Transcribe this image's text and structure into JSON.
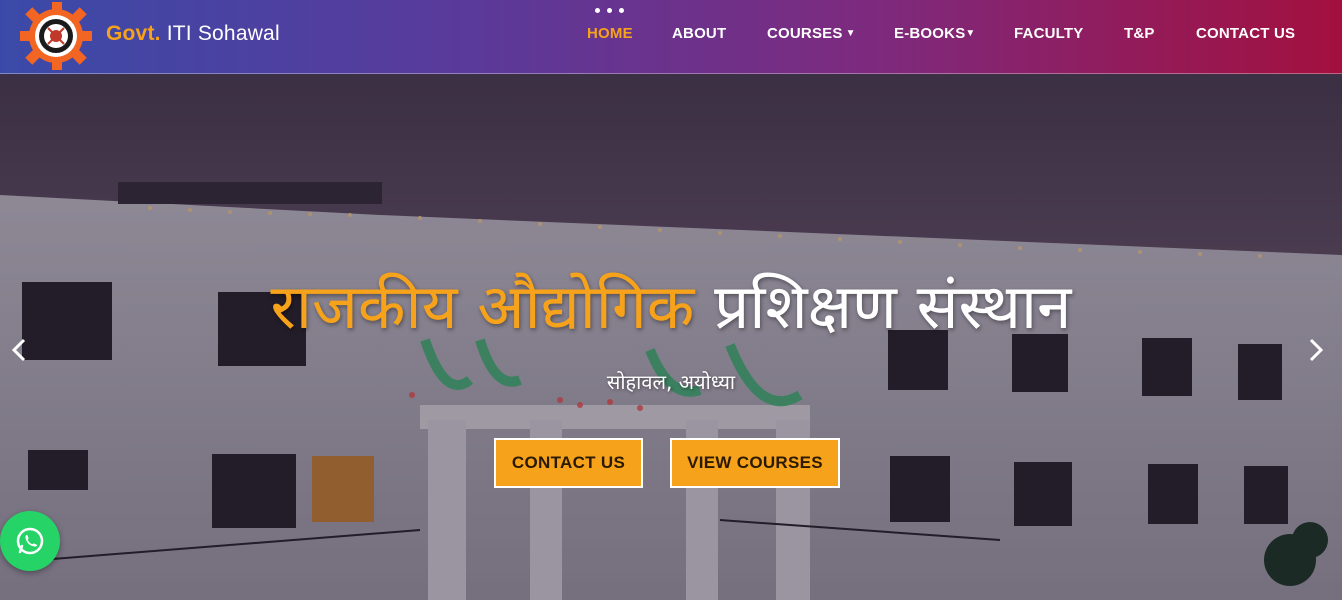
{
  "brand": {
    "accent": "Govt.",
    "name": "ITI Sohawal"
  },
  "nav": {
    "items": [
      {
        "label": "HOME",
        "active": true
      },
      {
        "label": "ABOUT"
      },
      {
        "label": "COURSES",
        "dropdown": true
      },
      {
        "label": "E-BOOKS",
        "dropdown": true
      },
      {
        "label": "FACULTY"
      },
      {
        "label": "T&P"
      },
      {
        "label": "CONTACT US"
      }
    ]
  },
  "hero": {
    "title_highlight": "राजकीय औद्योगिक",
    "title_rest": "प्रशिक्षण संस्थान",
    "subtitle": "सोहावल, अयोध्या",
    "buttons": {
      "contact": "CONTACT US",
      "courses": "VIEW COURSES"
    },
    "prev_icon": "chevron-left-icon",
    "next_icon": "chevron-right-icon"
  },
  "whatsapp": {
    "icon": "whatsapp-icon"
  },
  "colors": {
    "accent": "#f7a21b",
    "whatsapp": "#25d366",
    "header_start": "#3b4aa8",
    "header_end": "#a3103e"
  }
}
